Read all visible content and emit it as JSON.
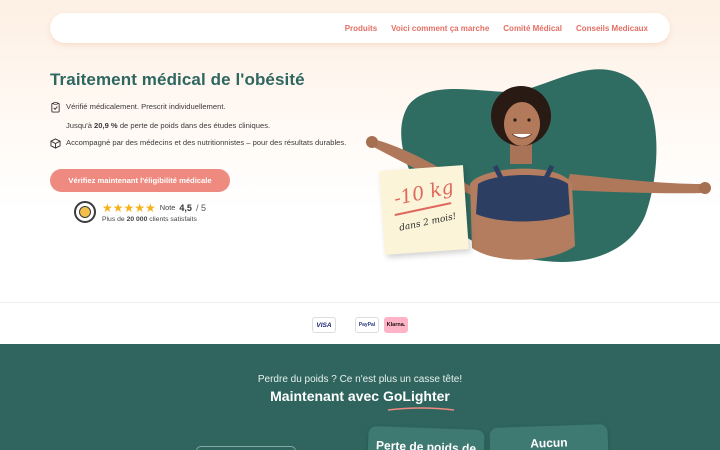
{
  "nav": {
    "links": [
      "Produits",
      "Voici comment ça marche",
      "Comité Médical",
      "Conseils Medicaux"
    ]
  },
  "hero": {
    "title": "Traitement médical de l'obésité",
    "features": [
      {
        "icon": "clipboard-check-icon",
        "text": "Vérifié médicalement. Prescrit individuellement."
      },
      {
        "icon": "none",
        "pre": "Jusqu'à ",
        "highlight": "20,9 %",
        "post": " de perte de poids dans des études cliniques."
      },
      {
        "icon": "box-icon",
        "text": "Accompagné par des médecins et des nutritionnistes – pour des résultats durables."
      }
    ],
    "cta_label": "Vérifiez maintenant l'éligibilité médicale",
    "rating": {
      "stars": 5,
      "note_label": "Note",
      "value": "4,5",
      "max": "/ 5",
      "clients_pre": "Plus de ",
      "clients_count": "20 000",
      "clients_post": " clients satisfaits"
    },
    "sticky_note": {
      "main": "-10 kg",
      "sub": "dans 2 mois!"
    }
  },
  "payments": [
    "VISA",
    "PayPal",
    "Klarna."
  ],
  "section": {
    "subtitle": "Perdre du poids ? Ce n'est plus un casse tête!",
    "title": "Maintenant avec GoLighter",
    "cards": [
      "Perte de poids de",
      "Aucun"
    ]
  },
  "colors": {
    "accent": "#ee8a7f",
    "nav_link": "#e36f63",
    "title_green": "#2e6660",
    "section_green": "#2f655e",
    "star": "#f5b21b"
  }
}
